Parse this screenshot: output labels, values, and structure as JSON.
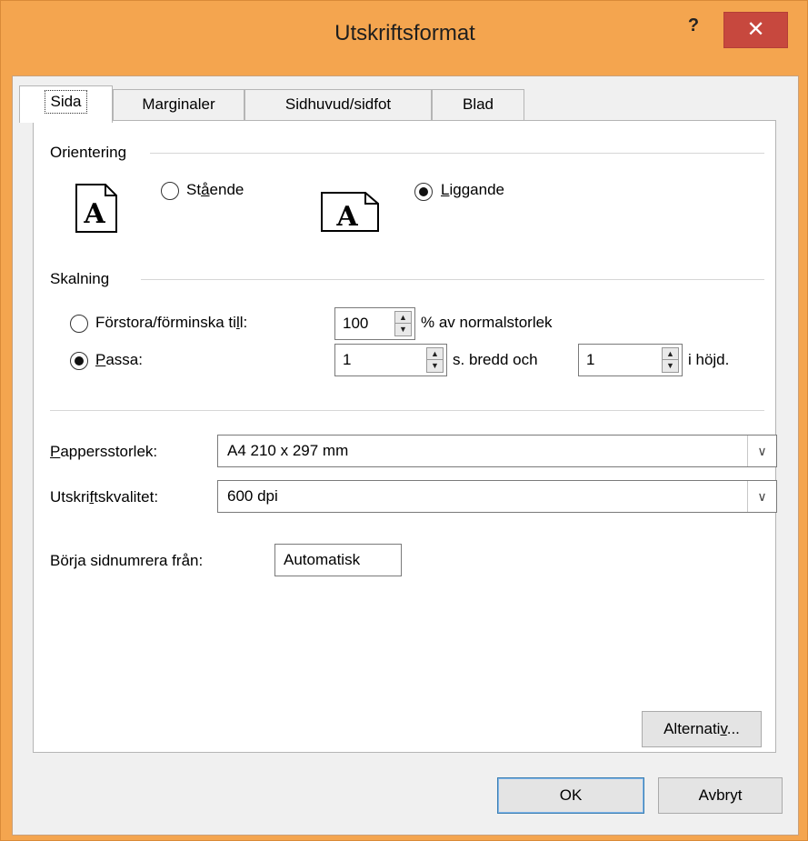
{
  "window": {
    "title": "Utskriftsformat",
    "help_label": "?",
    "close_label": "✕"
  },
  "tabs": [
    {
      "label": "Sida",
      "active": true
    },
    {
      "label": "Marginaler",
      "active": false
    },
    {
      "label": "Sidhuvud/sidfot",
      "active": false
    },
    {
      "label": "Blad",
      "active": false
    }
  ],
  "orientation": {
    "group_label": "Orientering",
    "portrait_prefix": "St",
    "portrait_accel": "å",
    "portrait_suffix": "ende",
    "portrait_checked": false,
    "landscape_prefix": "",
    "landscape_accel": "L",
    "landscape_suffix": "iggande",
    "landscape_checked": true,
    "icon_letter": "A"
  },
  "scaling": {
    "group_label": "Skalning",
    "adjust_prefix": "Förstora/förminska ti",
    "adjust_accel": "l",
    "adjust_suffix": "l:",
    "adjust_checked": false,
    "adjust_value": "100",
    "adjust_unit": "% av normalstorlek",
    "fit_prefix": "",
    "fit_accel": "P",
    "fit_suffix": "assa:",
    "fit_checked": true,
    "fit_wide_value": "1",
    "fit_wide_label": "s. bredd och",
    "fit_tall_value": "1",
    "fit_tall_label": "i höjd."
  },
  "paper": {
    "size_label_accel": "P",
    "size_label_rest": "appersstorlek:",
    "size_value": "A4 210 x 297 mm",
    "quality_label_prefix": "Utskri",
    "quality_label_accel": "f",
    "quality_label_suffix": "tskvalitet:",
    "quality_value": "600 dpi"
  },
  "numbering": {
    "label_prefix": "Bör",
    "label_accel": "j",
    "label_suffix": "a sidnumrera från:",
    "value": "Automatisk"
  },
  "buttons": {
    "options_prefix": "Alternati",
    "options_accel": "v",
    "options_suffix": "...",
    "ok": "OK",
    "cancel": "Avbryt"
  }
}
